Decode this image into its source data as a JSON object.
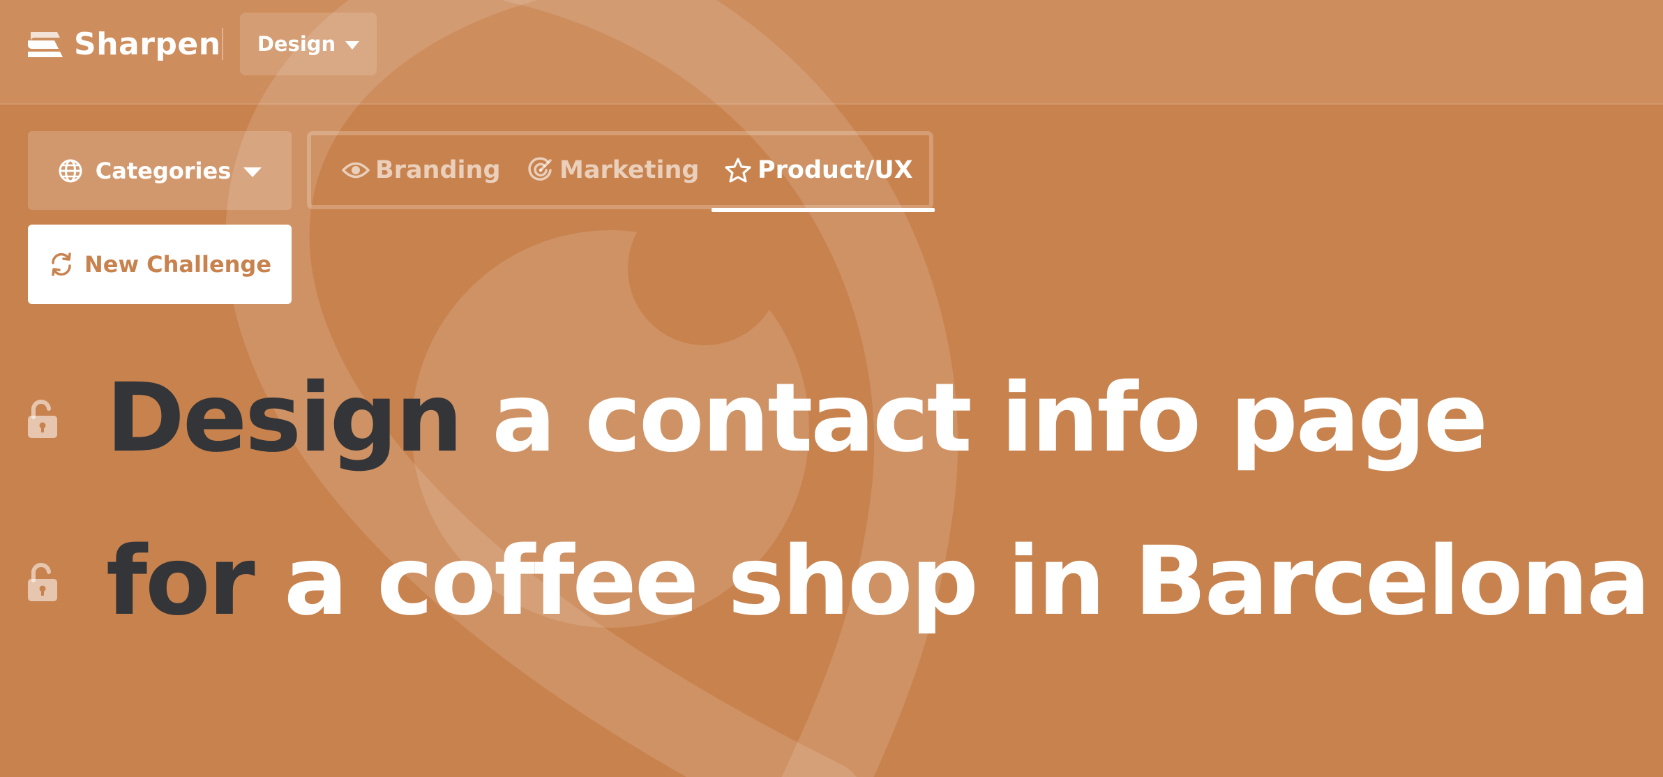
{
  "app": {
    "name": "Sharpen"
  },
  "header": {
    "design_dropdown": "Design"
  },
  "controls": {
    "categories_label": "Categories",
    "new_challenge_label": "New Challenge"
  },
  "tabs": [
    {
      "label": "Branding",
      "icon": "eye-icon",
      "active": false
    },
    {
      "label": "Marketing",
      "icon": "target-icon",
      "active": false
    },
    {
      "label": "Product/UX",
      "icon": "star-icon",
      "active": true
    }
  ],
  "headline": {
    "line1_keyword": "Design",
    "line1_rest": "a contact info page",
    "line2_keyword": "for",
    "line2_rest": "a coffee shop in Barcelona"
  },
  "colors": {
    "background": "#c8824e",
    "keyword_text": "#333538",
    "body_text": "#ffffff"
  }
}
